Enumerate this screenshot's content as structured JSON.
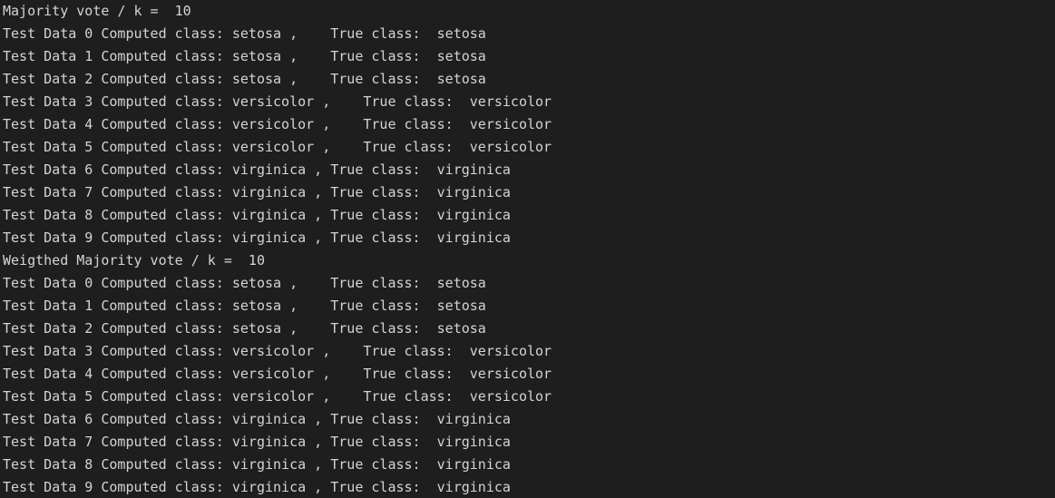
{
  "output": {
    "lines": [
      "Majority vote / k =  10",
      "Test Data 0 Computed class: setosa ,    True class:  setosa",
      "Test Data 1 Computed class: setosa ,    True class:  setosa",
      "Test Data 2 Computed class: setosa ,    True class:  setosa",
      "Test Data 3 Computed class: versicolor ,    True class:  versicolor",
      "Test Data 4 Computed class: versicolor ,    True class:  versicolor",
      "Test Data 5 Computed class: versicolor ,    True class:  versicolor",
      "Test Data 6 Computed class: virginica , True class:  virginica",
      "Test Data 7 Computed class: virginica , True class:  virginica",
      "Test Data 8 Computed class: virginica , True class:  virginica",
      "Test Data 9 Computed class: virginica , True class:  virginica",
      "Weigthed Majority vote / k =  10",
      "Test Data 0 Computed class: setosa ,    True class:  setosa",
      "Test Data 1 Computed class: setosa ,    True class:  setosa",
      "Test Data 2 Computed class: setosa ,    True class:  setosa",
      "Test Data 3 Computed class: versicolor ,    True class:  versicolor",
      "Test Data 4 Computed class: versicolor ,    True class:  versicolor",
      "Test Data 5 Computed class: versicolor ,    True class:  versicolor",
      "Test Data 6 Computed class: virginica , True class:  virginica",
      "Test Data 7 Computed class: virginica , True class:  virginica",
      "Test Data 8 Computed class: virginica , True class:  virginica",
      "Test Data 9 Computed class: virginica , True class:  virginica"
    ]
  }
}
